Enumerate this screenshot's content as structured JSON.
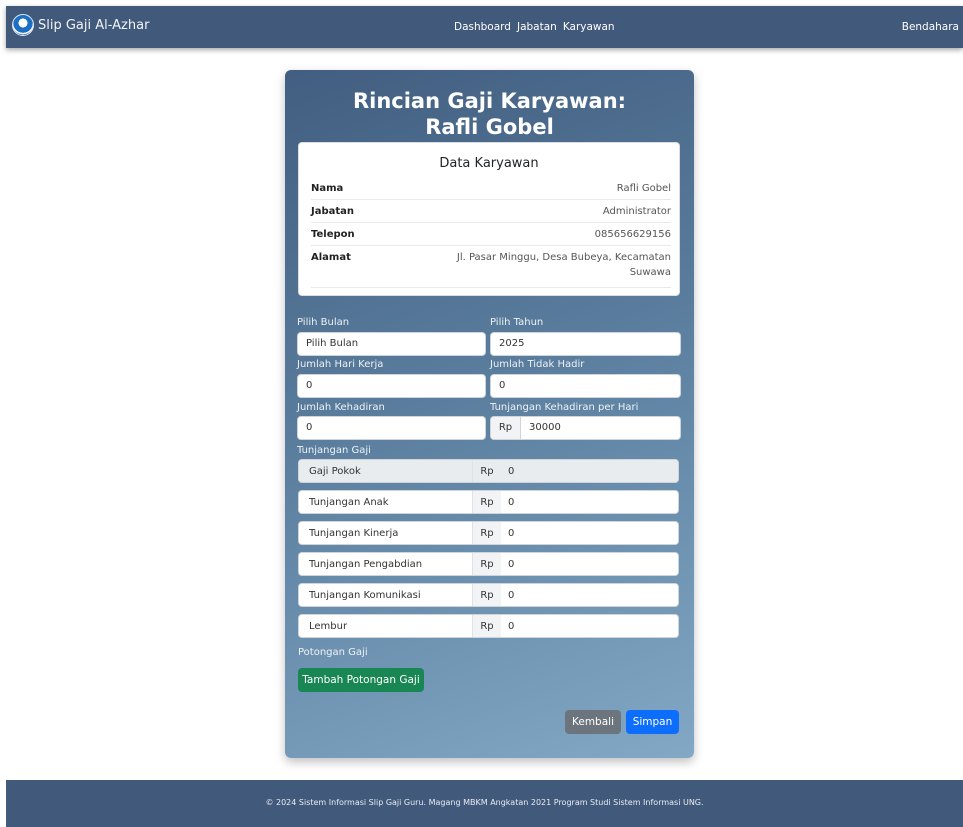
{
  "navbar": {
    "brand": "Slip Gaji Al-Azhar",
    "links": [
      "Dashboard",
      "Jabatan",
      "Karyawan"
    ],
    "user": "Bendahara"
  },
  "card": {
    "title_line1": "Rincian Gaji Karyawan:",
    "title_line2": "Rafli Gobel",
    "employee": {
      "heading": "Data Karyawan",
      "rows": [
        {
          "label": "Nama",
          "value": "Rafli Gobel"
        },
        {
          "label": "Jabatan",
          "value": "Administrator"
        },
        {
          "label": "Telepon",
          "value": "085656629156"
        },
        {
          "label": "Alamat",
          "value_line1": "Jl. Pasar Minggu, Desa Bubeya, Kecamatan",
          "value_line2": "Suwawa"
        }
      ]
    },
    "form": {
      "bulan_label": "Pilih Bulan",
      "bulan_value": "Pilih Bulan",
      "tahun_label": "Pilih Tahun",
      "tahun_value": "2025",
      "hari_kerja_label": "Jumlah Hari Kerja",
      "hari_kerja_value": "0",
      "tidak_hadir_label": "Jumlah Tidak Hadir",
      "tidak_hadir_value": "0",
      "kehadiran_label": "Jumlah Kehadiran",
      "kehadiran_value": "0",
      "tunj_hadir_label": "Tunjangan Kehadiran per Hari",
      "currency": "Rp",
      "tunj_hadir_value": "30000"
    },
    "tunjangan": {
      "heading": "Tunjangan Gaji",
      "items": [
        {
          "name": "Gaji Pokok",
          "value": "0"
        },
        {
          "name": "Tunjangan Anak",
          "value": "0"
        },
        {
          "name": "Tunjangan Kinerja",
          "value": "0"
        },
        {
          "name": "Tunjangan Pengabdian",
          "value": "0"
        },
        {
          "name": "Tunjangan Komunikasi",
          "value": "0"
        },
        {
          "name": "Lembur",
          "value": "0"
        }
      ]
    },
    "potongan": {
      "heading": "Potongan Gaji",
      "add_button": "Tambah Potongan Gaji"
    },
    "buttons": {
      "back": "Kembali",
      "save": "Simpan"
    }
  },
  "footer": {
    "text": "© 2024 Sistem Informasi Slip Gaji Guru. Magang MBKM Angkatan 2021 Program Studi Sistem Informasi UNG."
  },
  "colors": {
    "navbar": "#41597a",
    "green_button": "#198754",
    "blue_button": "#0d6efd",
    "grey_button": "#6c757d"
  }
}
